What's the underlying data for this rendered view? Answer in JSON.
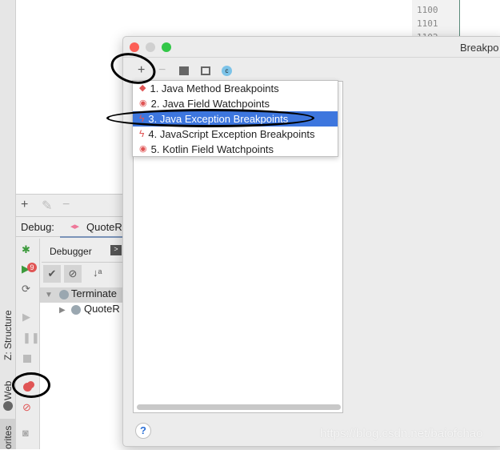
{
  "editor": {
    "line_numbers": [
      "1100",
      "1101",
      "1102"
    ]
  },
  "left_bar": {
    "structure": "Z: Structure",
    "web": "Web",
    "favorites": "orites"
  },
  "debug_panel": {
    "label": "Debug:",
    "config_tab": "QuoteRe",
    "debugger_tab": "Debugger",
    "tree": [
      {
        "label": "Terminate",
        "expanded": true
      },
      {
        "label": "QuoteR",
        "expanded": false
      }
    ],
    "badge": "9"
  },
  "dialog": {
    "title": "Breakpo",
    "help": "?"
  },
  "menu": {
    "items": [
      {
        "label": "1. Java Method Breakpoints",
        "icon": "diamond-breakpoint-icon",
        "selected": false
      },
      {
        "label": "2. Java Field Watchpoints",
        "icon": "eye-watchpoint-icon",
        "selected": false
      },
      {
        "label": "3. Java Exception Breakpoints",
        "icon": "lightning-icon",
        "selected": true
      },
      {
        "label": "4. JavaScript Exception Breakpoints",
        "icon": "lightning-icon",
        "selected": false
      },
      {
        "label": "5. Kotlin Field Watchpoints",
        "icon": "eye-watchpoint-icon",
        "selected": false
      }
    ]
  },
  "watermark": "https://blog.csdn.net/baiofchao",
  "colors": {
    "selection": "#3d76de",
    "breakpoint_red": "#e05555",
    "annotation": "#000000"
  }
}
